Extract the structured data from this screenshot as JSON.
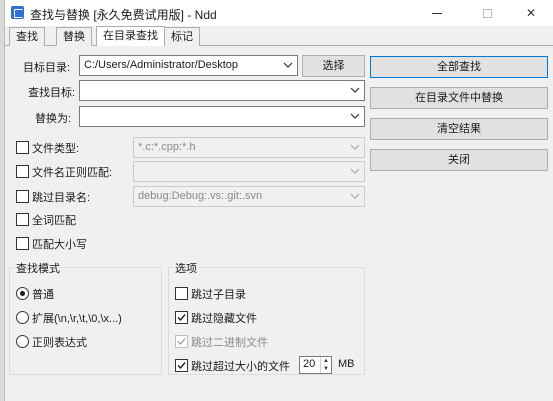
{
  "window": {
    "title": "查找与替换 [永久免费试用版] - Ndd",
    "minimize_glyph": "",
    "close_glyph": "✕"
  },
  "tabs": [
    {
      "label": "查找",
      "active": false
    },
    {
      "label": "替换",
      "active": false
    },
    {
      "label": "在目录查找",
      "active": true
    },
    {
      "label": "标记",
      "active": false
    }
  ],
  "form": {
    "target_dir_label": "目标目录:",
    "target_dir_value": "C:/Users/Administrator/Desktop",
    "browse_button": "选择",
    "find_label": "查找目标:",
    "find_value": "",
    "replace_label": "替换为:",
    "replace_value": "",
    "file_type_label": "文件类型:",
    "file_type_value": "*.c:*.cpp:*.h",
    "file_type_checked": false,
    "filename_regex_label": "文件名正则匹配:",
    "filename_regex_value": "",
    "filename_regex_checked": false,
    "skip_dir_label": "跳过目录名:",
    "skip_dir_value": "debug:Debug:.vs:.git:.svn",
    "skip_dir_checked": false,
    "whole_word_label": "全词匹配",
    "whole_word_checked": false,
    "match_case_label": "匹配大小写",
    "match_case_checked": false
  },
  "actions": {
    "find_all": "全部查找",
    "replace_in_files": "在目录文件中替换",
    "clear_results": "清空结果",
    "close": "关闭"
  },
  "search_mode": {
    "title": "查找模式",
    "options": [
      {
        "label": "普通",
        "selected": true
      },
      {
        "label": "扩展(\\n,\\r,\\t,\\0,\\x...)",
        "selected": false
      },
      {
        "label": "正则表达式",
        "selected": false
      }
    ]
  },
  "options": {
    "title": "选项",
    "skip_subdir": {
      "label": "跳过子目录",
      "checked": false,
      "enabled": true
    },
    "skip_hidden": {
      "label": "跳过隐藏文件",
      "checked": true,
      "enabled": true
    },
    "skip_binary": {
      "label": "跳过二进制文件",
      "checked": true,
      "enabled": false
    },
    "skip_large": {
      "label": "跳过超过大小的文件",
      "checked": true,
      "enabled": true
    },
    "size_value": "20",
    "size_unit": "MB"
  },
  "colors": {
    "accent": "#0078d7",
    "app_icon": "#2f6fcf",
    "window_bg": "#f0f0f0"
  }
}
